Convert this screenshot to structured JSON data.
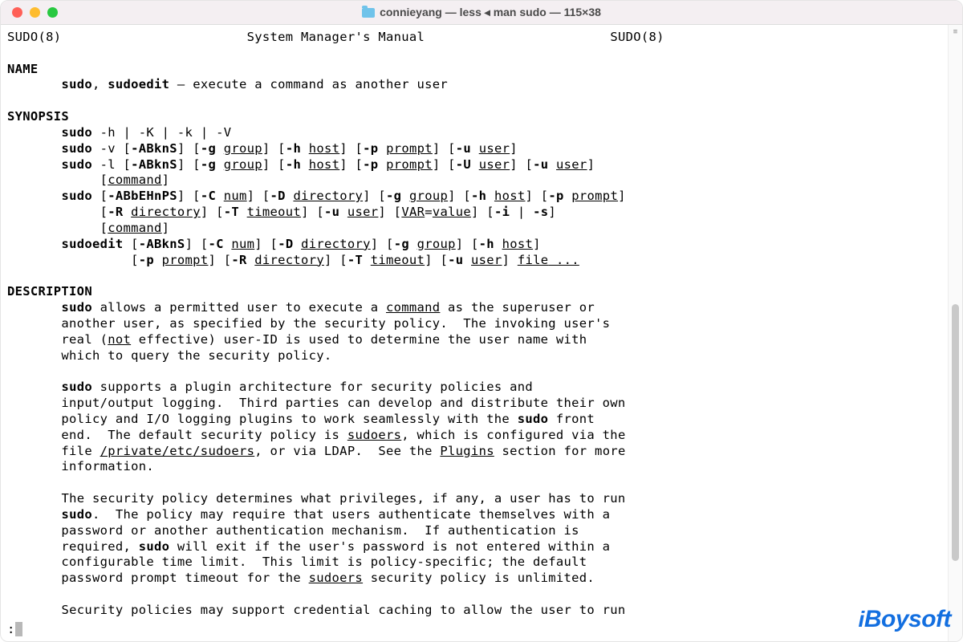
{
  "window": {
    "title": "connieyang — less ◂ man sudo — 115×38"
  },
  "header": {
    "left": "SUDO(8)",
    "center": "System Manager's Manual",
    "right": "SUDO(8)"
  },
  "sections": {
    "name_heading": "NAME",
    "name_line_cmds": "sudo",
    "name_line_sep": ", ",
    "name_line_cmd2": "sudoedit",
    "name_line_rest": " – execute a command as another user",
    "synopsis_heading": "SYNOPSIS",
    "syn1_cmd": "sudo",
    "syn1_rest": " -h | -K | -k | -V",
    "syn2_cmd": "sudo",
    "syn2_a": " -v [",
    "syn2_flags": "-ABknS",
    "syn2_b": "] [",
    "syn2_g": "-g",
    "syn2_sp": " ",
    "syn2_group": "group",
    "syn2_c": "] [",
    "syn2_h": "-h",
    "syn2_host": "host",
    "syn2_d": "] [",
    "syn2_p": "-p",
    "syn2_prompt": "prompt",
    "syn2_e": "] [",
    "syn2_u": "-u",
    "syn2_user": "user",
    "syn2_f": "]",
    "syn3_cmd": "sudo",
    "syn3_a": " -l [",
    "syn3_flags": "-ABknS",
    "syn3_b": "] [",
    "syn3_g": "-g",
    "syn3_group": "group",
    "syn3_c": "] [",
    "syn3_h": "-h",
    "syn3_host": "host",
    "syn3_d": "] [",
    "syn3_p": "-p",
    "syn3_prompt": "prompt",
    "syn3_e": "] [",
    "syn3_U": "-U",
    "syn3_user1": "user",
    "syn3_f": "] [",
    "syn3_u": "-u",
    "syn3_user2": "user",
    "syn3_g2": "]",
    "syn3_line2_open": "[",
    "syn3_command": "command",
    "syn3_line2_close": "]",
    "syn4_cmd": "sudo",
    "syn4_a": " [",
    "syn4_flags": "-ABbEHnPS",
    "syn4_b": "] [",
    "syn4_C": "-C",
    "syn4_num": "num",
    "syn4_c": "] [",
    "syn4_D": "-D",
    "syn4_dir": "directory",
    "syn4_d": "] [",
    "syn4_g": "-g",
    "syn4_group": "group",
    "syn4_e": "] [",
    "syn4_h": "-h",
    "syn4_host": "host",
    "syn4_f": "] [",
    "syn4_p": "-p",
    "syn4_prompt": "prompt",
    "syn4_g2": "]",
    "syn4_l2_a": "[",
    "syn4_R": "-R",
    "syn4_dir2": "directory",
    "syn4_l2_b": "] [",
    "syn4_T": "-T",
    "syn4_timeout": "timeout",
    "syn4_l2_c": "] [",
    "syn4_u": "-u",
    "syn4_user": "user",
    "syn4_l2_d": "] [",
    "syn4_var": "VAR",
    "syn4_eq": "=",
    "syn4_value": "value",
    "syn4_l2_e": "] [",
    "syn4_i": "-i",
    "syn4_pipe": " | ",
    "syn4_s": "-s",
    "syn4_l2_f": "]",
    "syn4_l3_open": "[",
    "syn4_command": "command",
    "syn4_l3_close": "]",
    "syn5_cmd": "sudoedit",
    "syn5_a": " [",
    "syn5_flags": "-ABknS",
    "syn5_b": "] [",
    "syn5_C": "-C",
    "syn5_num": "num",
    "syn5_c": "] [",
    "syn5_D": "-D",
    "syn5_dir": "directory",
    "syn5_d": "] [",
    "syn5_g": "-g",
    "syn5_group": "group",
    "syn5_e": "] [",
    "syn5_h": "-h",
    "syn5_host": "host",
    "syn5_f": "]",
    "syn5_l2_a": "[",
    "syn5_p": "-p",
    "syn5_prompt": "prompt",
    "syn5_l2_b": "] [",
    "syn5_R": "-R",
    "syn5_dir2": "directory",
    "syn5_l2_c": "] [",
    "syn5_T": "-T",
    "syn5_timeout": "timeout",
    "syn5_l2_d": "] [",
    "syn5_u": "-u",
    "syn5_user": "user",
    "syn5_l2_e": "] ",
    "syn5_file": "file",
    "syn5_dots": " ...",
    "desc_heading": "DESCRIPTION",
    "desc_p1_a": "sudo",
    "desc_p1_b": " allows a permitted user to execute a ",
    "desc_p1_cmd": "command",
    "desc_p1_c": " as the superuser or\n       another user, as specified by the security policy.  The invoking user's\n       real (",
    "desc_p1_not": "not",
    "desc_p1_d": " effective) user-ID is used to determine the user name with\n       which to query the security policy.",
    "desc_p2_a": "sudo",
    "desc_p2_b": " supports a plugin architecture for security policies and\n       input/output logging.  Third parties can develop and distribute their own\n       policy and I/O logging plugins to work seamlessly with the ",
    "desc_p2_c": "sudo",
    "desc_p2_d": " front\n       end.  The default security policy is ",
    "desc_p2_sudoers": "sudoers",
    "desc_p2_e": ", which is configured via the\n       file ",
    "desc_p2_path": "/private/etc/sudoers",
    "desc_p2_f": ", or via LDAP.  See the ",
    "desc_p2_plugins": "Plugins",
    "desc_p2_g": " section for more\n       information.",
    "desc_p3_a": "The security policy determines what privileges, if any, a user has to run\n       ",
    "desc_p3_b": "sudo",
    "desc_p3_c": ".  The policy may require that users authenticate themselves with a\n       password or another authentication mechanism.  If authentication is\n       required, ",
    "desc_p3_d": "sudo",
    "desc_p3_e": " will exit if the user's password is not entered within a\n       configurable time limit.  This limit is policy-specific; the default\n       password prompt timeout for the ",
    "desc_p3_sudoers": "sudoers",
    "desc_p3_f": " security policy is unlimited.",
    "desc_p4": "Security policies may support credential caching to allow the user to run"
  },
  "prompt": ":",
  "watermark": "iBoysoft"
}
